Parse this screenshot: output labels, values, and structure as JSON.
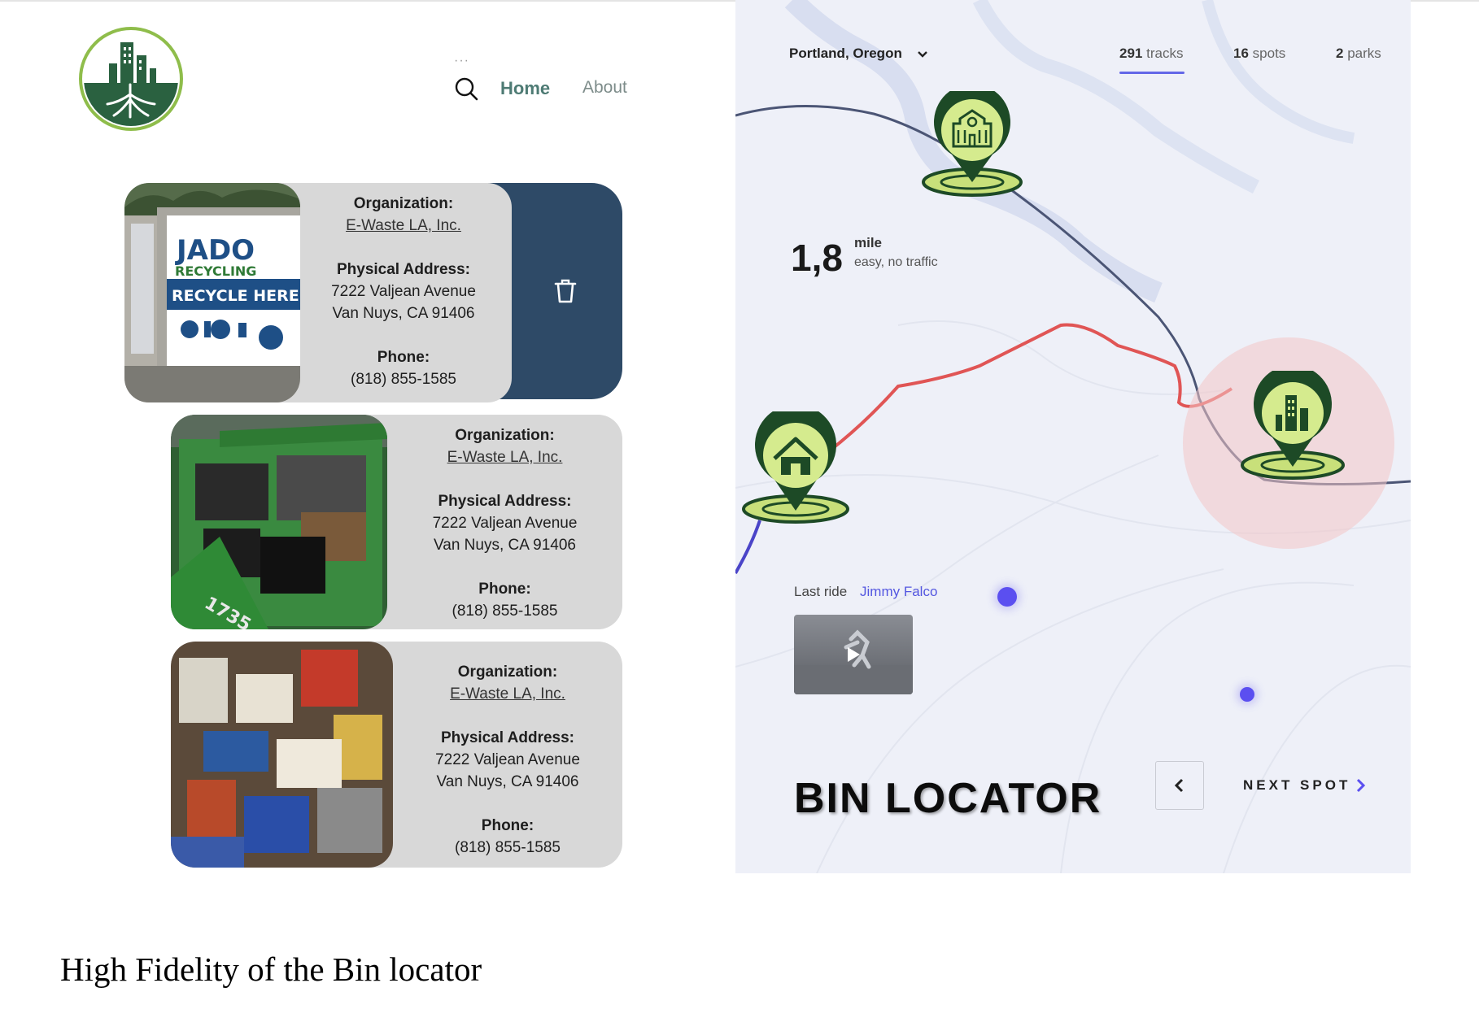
{
  "nav": {
    "home_label": "Home",
    "about_label": "About"
  },
  "listings": [
    {
      "org_label": "Organization:",
      "org_name": "E-Waste LA, Inc.",
      "address_label": "Physical Address:",
      "address_line1": "7222 Valjean Avenue",
      "address_line2": "Van Nuys, CA 91406",
      "phone_label": "Phone:",
      "phone": "(818) 855-1585",
      "photo": "jado-recycling-sign",
      "sign": {
        "line1": "JADO",
        "line2": "RECYCLING",
        "line3": "RECYCLE HERE"
      }
    },
    {
      "org_label": "Organization:",
      "org_name": "E-Waste LA, Inc.",
      "address_label": "Physical Address:",
      "address_line1": "7222 Valjean Avenue",
      "address_line2": "Van Nuys, CA 91406",
      "phone_label": "Phone:",
      "phone": "(818) 855-1585",
      "photo": "e-waste-bins"
    },
    {
      "org_label": "Organization:",
      "org_name": "E-Waste LA, Inc.",
      "address_label": "Physical Address:",
      "address_line1": "7222 Valjean Avenue",
      "address_line2": "Van Nuys, CA 91406",
      "phone_label": "Phone:",
      "phone": "(818) 855-1585",
      "photo": "hazardous-waste-containers"
    }
  ],
  "map": {
    "city": "Portland, Oregon",
    "stats": {
      "tracks_count": "291",
      "tracks_label": "tracks",
      "spots_count": "16",
      "spots_label": "spots",
      "parks_count": "2",
      "parks_label": "parks"
    },
    "distance_value": "1,8",
    "distance_unit": "mile",
    "distance_note": "easy, no traffic",
    "last_ride_label": "Last ride",
    "last_ride_user": "Jimmy Falco",
    "title": "BIN LOCATOR",
    "next_label": "NEXT SPOT"
  },
  "colors": {
    "brand_green": "#2a6140",
    "pin_fill": "#d5eb8e",
    "delete_bg": "#2e4a67",
    "accent": "#5b4ff0",
    "route_red": "#e05555"
  },
  "caption": "High Fidelity of the Bin locator"
}
